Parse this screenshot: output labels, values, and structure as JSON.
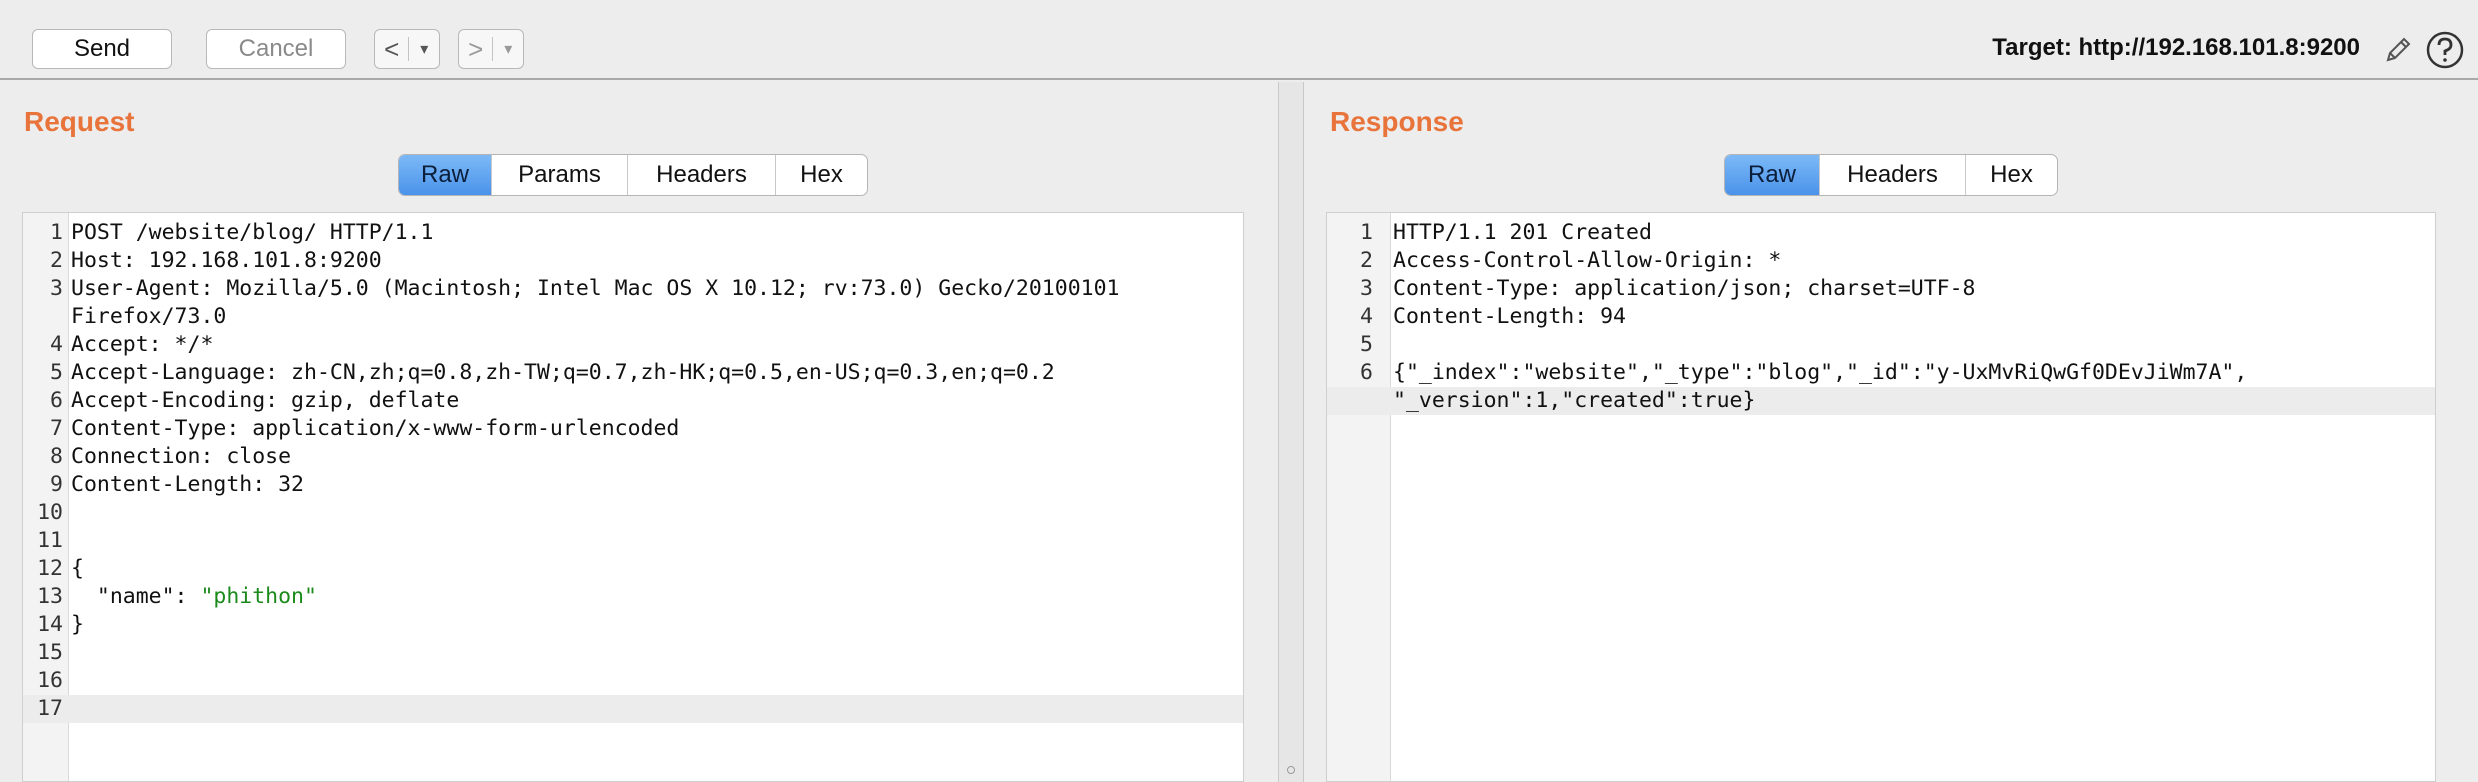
{
  "toolbar": {
    "send_label": "Send",
    "cancel_label": "Cancel",
    "back_arrow": "<",
    "forward_arrow": ">",
    "dropdown_glyph": "▾",
    "target_label": "Target: http://192.168.101.8:9200",
    "edit_icon": "pencil-icon",
    "help_icon": "help-icon"
  },
  "request": {
    "title": "Request",
    "tabs": [
      "Raw",
      "Params",
      "Headers",
      "Hex"
    ],
    "active_tab": "Raw",
    "lines": [
      {
        "n": "1",
        "text": "POST /website/blog/ HTTP/1.1"
      },
      {
        "n": "2",
        "text": "Host: 192.168.101.8:9200"
      },
      {
        "n": "3",
        "text": "User-Agent: Mozilla/5.0 (Macintosh; Intel Mac OS X 10.12; rv:73.0) Gecko/20100101"
      },
      {
        "n": "",
        "text": "Firefox/73.0"
      },
      {
        "n": "4",
        "text": "Accept: */*"
      },
      {
        "n": "5",
        "text": "Accept-Language: zh-CN,zh;q=0.8,zh-TW;q=0.7,zh-HK;q=0.5,en-US;q=0.3,en;q=0.2"
      },
      {
        "n": "6",
        "text": "Accept-Encoding: gzip, deflate"
      },
      {
        "n": "7",
        "text": "Content-Type: application/x-www-form-urlencoded"
      },
      {
        "n": "8",
        "text": "Connection: close"
      },
      {
        "n": "9",
        "text": "Content-Length: 32"
      },
      {
        "n": "10",
        "text": ""
      },
      {
        "n": "11",
        "text": ""
      },
      {
        "n": "12",
        "text": "{"
      },
      {
        "n": "13",
        "text": "  \"name\": ",
        "str": "\"phithon\""
      },
      {
        "n": "14",
        "text": "}"
      },
      {
        "n": "15",
        "text": ""
      },
      {
        "n": "16",
        "text": ""
      },
      {
        "n": "17",
        "text": ""
      }
    ]
  },
  "response": {
    "title": "Response",
    "tabs": [
      "Raw",
      "Headers",
      "Hex"
    ],
    "active_tab": "Raw",
    "lines": [
      {
        "n": "1",
        "text": "HTTP/1.1 201 Created"
      },
      {
        "n": "2",
        "text": "Access-Control-Allow-Origin: *"
      },
      {
        "n": "3",
        "text": "Content-Type: application/json; charset=UTF-8"
      },
      {
        "n": "4",
        "text": "Content-Length: 94"
      },
      {
        "n": "5",
        "text": ""
      },
      {
        "n": "6",
        "text": "{\"_index\":\"website\",\"_type\":\"blog\",\"_id\":\"y-UxMvRiQwGf0DEvJiWm7A\","
      },
      {
        "n": "",
        "text": "\"_version\":1,\"created\":true}"
      }
    ]
  }
}
